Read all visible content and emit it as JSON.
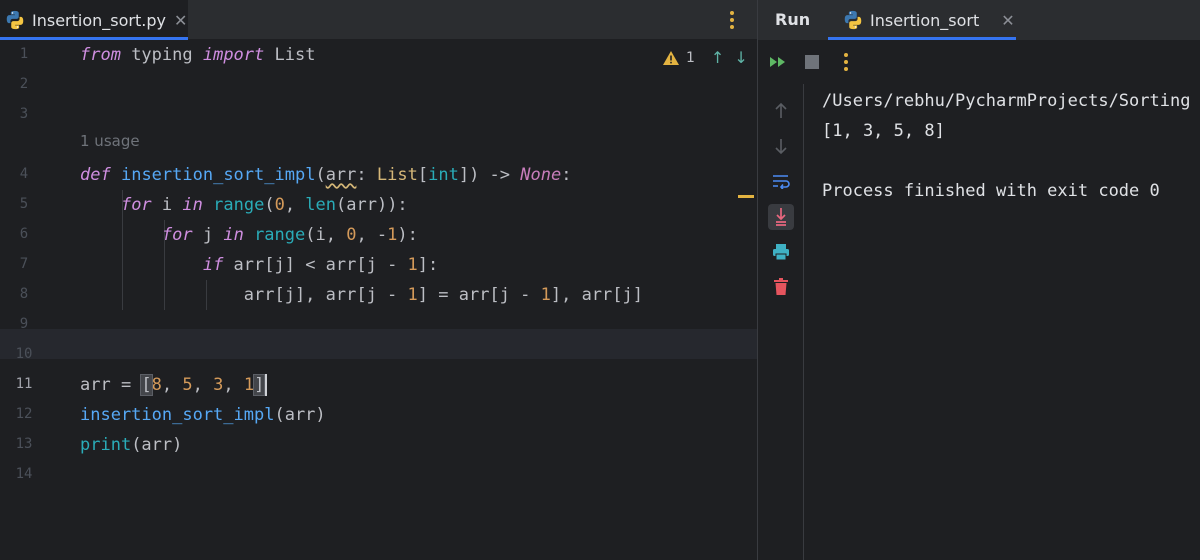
{
  "editor": {
    "tab": {
      "label": "Insertion_sort.py"
    },
    "inspection": {
      "warning_count": "1"
    },
    "usage_hint": "1 usage",
    "line_numbers": [
      "1",
      "2",
      "3",
      "4",
      "5",
      "6",
      "7",
      "8",
      "9",
      "10",
      "11",
      "12",
      "13",
      "14"
    ],
    "current_line": "11",
    "code": {
      "l1": {
        "kw1": "from",
        "t1": " typing ",
        "kw2": "import",
        "t2": " List"
      },
      "l4": {
        "kw": "def",
        "sp": " ",
        "fn": "insertion_sort_impl",
        "op": "(",
        "param": "arr",
        "colon": ": ",
        "type": "List",
        "ob": "[",
        "int": "int",
        "cb": "]",
        "close": ") -> ",
        "none": "None",
        "end": ":"
      },
      "l5": {
        "indent": "    ",
        "kw": "for",
        "t1": " i ",
        "kw2": "in",
        "sp": " ",
        "bi1": "range",
        "t2": "(",
        "n0": "0",
        "t3": ", ",
        "bi2": "len",
        "t4": "(arr)):"
      },
      "l6": {
        "indent": "        ",
        "kw": "for",
        "t1": " j ",
        "kw2": "in",
        "sp": " ",
        "bi": "range",
        "t2": "(i, ",
        "n0": "0",
        "t3": ", -",
        "n1": "1",
        "t4": "):"
      },
      "l7": {
        "indent": "            ",
        "kw": "if",
        "t1": " arr[j] < arr[j - ",
        "n1": "1",
        "t2": "]:"
      },
      "l8": {
        "indent": "                ",
        "t1": "arr[j], arr[j - ",
        "n1": "1",
        "t2": "] = arr[j - ",
        "n2": "1",
        "t3": "], arr[j]"
      },
      "l11": {
        "t1": "arr = ",
        "ob": "[",
        "n1": "8",
        "s1": ", ",
        "n2": "5",
        "s2": ", ",
        "n3": "3",
        "s3": ", ",
        "n4": "1",
        "cb": "]"
      },
      "l12": {
        "fn": "insertion_sort_impl",
        "t": "(arr)"
      },
      "l13": {
        "bi": "print",
        "t": "(arr)"
      }
    }
  },
  "run": {
    "title": "Run",
    "tab": {
      "label": "Insertion_sort"
    },
    "console": [
      "/Users/rebhu/PycharmProjects/Sorting",
      "[1, 3, 5, 8]",
      "",
      "Process finished with exit code 0"
    ]
  },
  "icons": {
    "file": "python-icon",
    "warning": "warning-triangle-icon",
    "prev": "arrow-up-icon",
    "next": "arrow-down-icon",
    "rerun": "rerun-icon",
    "stop": "stop-icon",
    "more": "more-vertical-icon",
    "soft_wrap": "soft-wrap-icon",
    "scroll_end": "scroll-to-end-icon",
    "print": "print-icon",
    "clear": "trash-icon"
  },
  "colors": {
    "keyword": "#cf8ee0",
    "function": "#56a8f5",
    "builtin": "#2aacb8",
    "number": "#d49a5a",
    "accent": "#3574f0",
    "warning": "#e3b341"
  }
}
